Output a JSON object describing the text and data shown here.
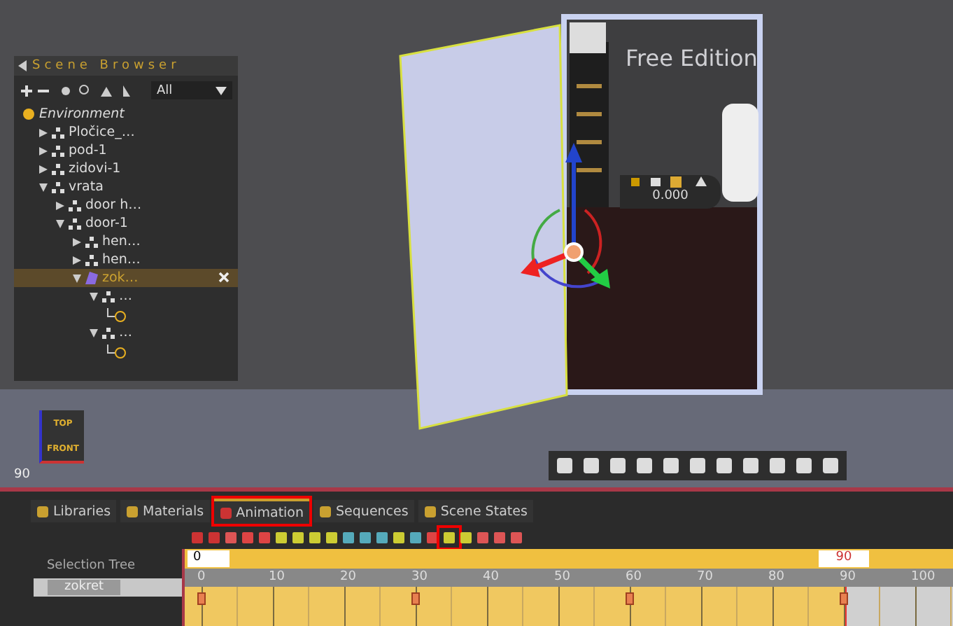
{
  "scene_browser": {
    "title": "Scene Browser",
    "filter": "All",
    "tree": [
      {
        "label": "Environment",
        "kind": "environment",
        "selected": false,
        "children": [
          {
            "label": "Pločice_…",
            "kind": "group",
            "expanded": false,
            "selected": false
          },
          {
            "label": "pod-1",
            "kind": "group",
            "expanded": false,
            "selected": false
          },
          {
            "label": "zidovi-1",
            "kind": "group",
            "expanded": false,
            "selected": false
          },
          {
            "label": "vrata",
            "kind": "group",
            "expanded": true,
            "selected": false,
            "children": [
              {
                "label": "door h…",
                "kind": "group",
                "expanded": false,
                "selected": false
              },
              {
                "label": "door-1",
                "kind": "group",
                "expanded": true,
                "selected": false,
                "children": [
                  {
                    "label": "hen…",
                    "kind": "group",
                    "expanded": false,
                    "selected": false
                  },
                  {
                    "label": "hen…",
                    "kind": "group",
                    "expanded": false,
                    "selected": false
                  },
                  {
                    "label": "zok…",
                    "kind": "animation",
                    "expanded": true,
                    "selected": true,
                    "children": [
                      {
                        "label": "…",
                        "kind": "group",
                        "expanded": true,
                        "selected": false,
                        "children": [
                          {
                            "kind": "mesh",
                            "selected": false
                          }
                        ]
                      },
                      {
                        "label": "…",
                        "kind": "group",
                        "expanded": true,
                        "selected": false,
                        "children": [
                          {
                            "kind": "mesh",
                            "selected": false
                          }
                        ]
                      }
                    ]
                  }
                ]
              }
            ]
          }
        ]
      }
    ]
  },
  "viewport": {
    "watermark": "Free Edition",
    "gizmo_value": "0.000",
    "view_cube_top": "TOP",
    "view_cube_front": "FRONT",
    "frame": "90"
  },
  "tabs": [
    {
      "label": "Libraries",
      "selected": false,
      "highlighted": false
    },
    {
      "label": "Materials",
      "selected": false,
      "highlighted": false
    },
    {
      "label": "Animation",
      "selected": true,
      "highlighted": true
    },
    {
      "label": "Sequences",
      "selected": false,
      "highlighted": false
    },
    {
      "label": "Scene States",
      "selected": false,
      "highlighted": false
    }
  ],
  "timeline": {
    "start": "0",
    "end": "90",
    "selection_tree_label": "Selection Tree",
    "track": "zokret",
    "ruler": [
      {
        "label": "0",
        "keyframe": true,
        "end": false
      },
      {
        "label": "10",
        "keyframe": false,
        "end": false
      },
      {
        "label": "20",
        "keyframe": false,
        "end": false
      },
      {
        "label": "30",
        "keyframe": true,
        "end": false
      },
      {
        "label": "40",
        "keyframe": false,
        "end": false
      },
      {
        "label": "50",
        "keyframe": false,
        "end": false
      },
      {
        "label": "60",
        "keyframe": true,
        "end": false
      },
      {
        "label": "70",
        "keyframe": false,
        "end": false
      },
      {
        "label": "80",
        "keyframe": false,
        "end": false
      },
      {
        "label": "90",
        "keyframe": true,
        "end": true
      },
      {
        "label": "100",
        "keyframe": false,
        "end": false
      }
    ]
  }
}
